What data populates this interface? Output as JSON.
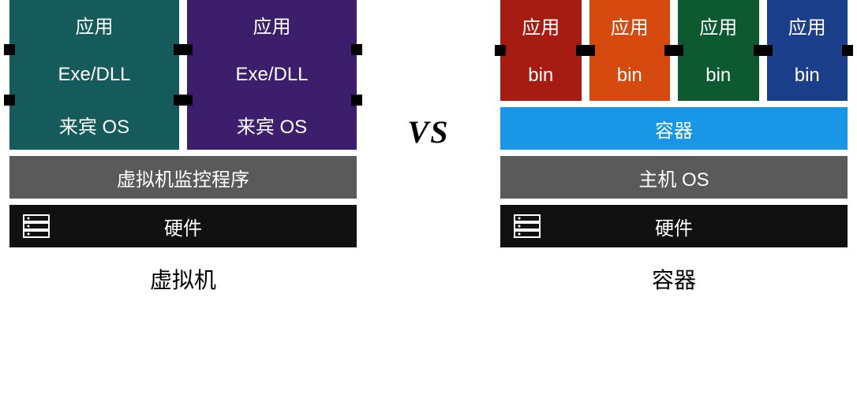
{
  "vs_label": "VS",
  "left": {
    "stacks": [
      {
        "color": "c-teal",
        "cells": [
          "应用",
          "Exe/DLL",
          "来宾 OS"
        ]
      },
      {
        "color": "c-purple",
        "cells": [
          "应用",
          "Exe/DLL",
          "来宾 OS"
        ]
      }
    ],
    "infra": {
      "hypervisor": "虚拟机监控程序",
      "hardware": "硬件"
    },
    "caption": "虚拟机"
  },
  "right": {
    "stacks": [
      {
        "color": "c-red",
        "cells": [
          "应用",
          "bin"
        ]
      },
      {
        "color": "c-orange",
        "cells": [
          "应用",
          "bin"
        ]
      },
      {
        "color": "c-green",
        "cells": [
          "应用",
          "bin"
        ]
      },
      {
        "color": "c-blue",
        "cells": [
          "应用",
          "bin"
        ]
      }
    ],
    "container_bar": "容器",
    "infra": {
      "host_os": "主机 OS",
      "hardware": "硬件"
    },
    "caption": "容器"
  }
}
